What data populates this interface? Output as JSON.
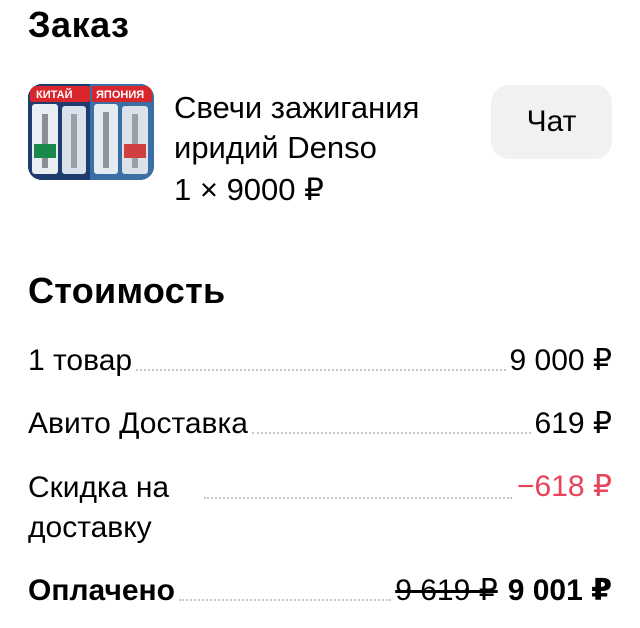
{
  "order": {
    "title": "Заказ",
    "product": {
      "name": "Свечи зажигания иридий Denso",
      "quantity_price": "1 × 9000 ₽",
      "image_labels": {
        "left": "КИТАЙ",
        "right": "ЯПОНИЯ"
      }
    },
    "chat_label": "Чат"
  },
  "cost": {
    "title": "Стоимость",
    "items_label": "1 товар",
    "items_value": "9 000 ₽",
    "delivery_label": "Авито Доставка",
    "delivery_value": "619 ₽",
    "discount_label": "Скидка на доставку",
    "discount_value": "−618 ₽",
    "paid_label": "Оплачено",
    "paid_old_value": "9 619 ₽",
    "paid_value": "9 001 ₽"
  },
  "colors": {
    "discount": "#e8435a",
    "chat_button_bg": "#f2f1f0"
  }
}
